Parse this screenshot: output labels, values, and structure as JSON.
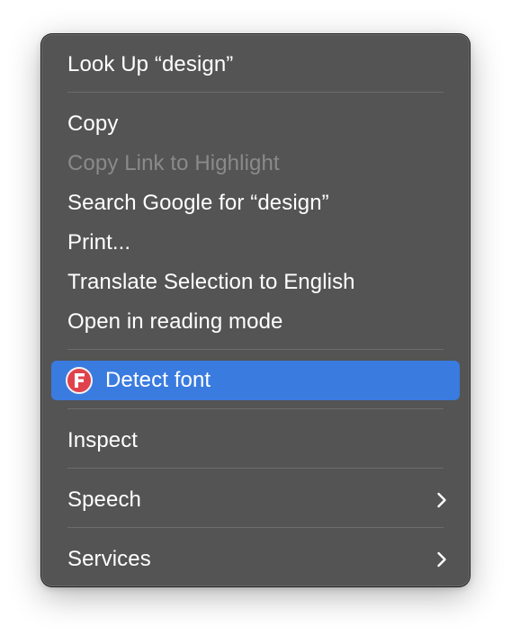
{
  "menu": {
    "look_up": "Look Up “design”",
    "copy": "Copy",
    "copy_link_to_highlight": "Copy Link to Highlight",
    "search_google": "Search Google for “design”",
    "print": "Print...",
    "translate": "Translate Selection to English",
    "reading_mode": "Open in reading mode",
    "detect_font": "Detect font",
    "detect_font_icon": "font-detector-icon",
    "inspect": "Inspect",
    "speech": "Speech",
    "services": "Services",
    "submenu_icon": "chevron-right-icon"
  },
  "colors": {
    "menu_background": "#545454",
    "highlight": "#3a7be0",
    "text": "#ffffff",
    "disabled_text": "#8a8a8a",
    "app_icon": "#e0424c"
  }
}
